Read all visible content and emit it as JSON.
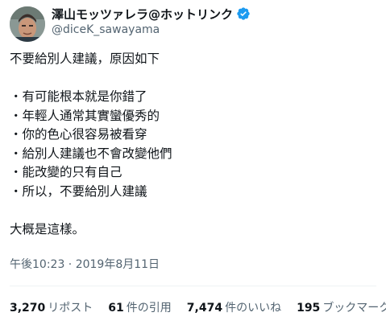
{
  "user": {
    "display_name": "澤山モッツァレラ@ホットリンク",
    "handle": "@diceK_sawayama",
    "verified_icon": "verified-badge-icon",
    "verified_color": "#1d9bf0"
  },
  "tweet": {
    "lines": [
      "不要給別人建議，原因如下",
      "",
      "・有可能根本就是你錯了",
      "・年輕人通常其實蠻優秀的",
      "・你的色心很容易被看穿",
      "・給別人建議也不會改變他們",
      "・能改變的只有自己",
      "・所以，不要給別人建議",
      "",
      "大概是這樣。"
    ],
    "timestamp": "午後10:23 · 2019年8月11日"
  },
  "stats": [
    {
      "count": "3,270",
      "label": "リポスト"
    },
    {
      "count": "61",
      "label": "件の引用"
    },
    {
      "count": "7,474",
      "label": "件のいいね"
    },
    {
      "count": "195",
      "label": "ブックマーク"
    }
  ],
  "colors": {
    "text": "#0f1419",
    "secondary": "#536471",
    "divider": "#eff3f4"
  }
}
